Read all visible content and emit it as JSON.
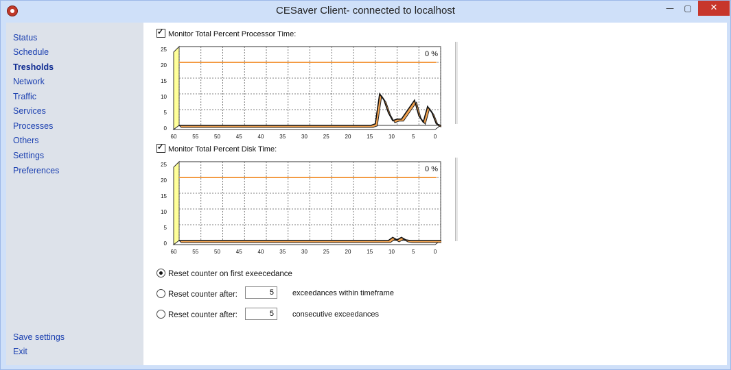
{
  "window": {
    "title": "CESaver Client- connected to localhost",
    "min_icon": "—",
    "max_icon": "▢",
    "close_icon": "✕"
  },
  "sidebar": {
    "items": [
      {
        "label": "Status"
      },
      {
        "label": "Schedule"
      },
      {
        "label": "Tresholds",
        "active": true
      },
      {
        "label": "Network"
      },
      {
        "label": "Traffic"
      },
      {
        "label": "Services"
      },
      {
        "label": "Processes"
      },
      {
        "label": "Others"
      },
      {
        "label": "Settings"
      },
      {
        "label": "Preferences"
      }
    ],
    "bottom": [
      {
        "label": "Save settings"
      },
      {
        "label": "Exit"
      }
    ]
  },
  "monitors": [
    {
      "label": "Monitor Total Percent Processor Time:",
      "checked": true
    },
    {
      "label": "Monitor Total Percent Disk Time:",
      "checked": true
    }
  ],
  "options": {
    "radio1": "Reset counter on first exeecedance",
    "radio2": "Reset counter after:",
    "radio2_value": "5",
    "radio2_suffix": "exceedances within timeframe",
    "radio3": "Reset counter after:",
    "radio3_value": "5",
    "radio3_suffix": "consecutive exceedances",
    "selected": 1
  },
  "colors": {
    "threshold": "#f39b44",
    "series_fill": "#f3a350",
    "axis_fill": "#ffff99",
    "grid": "#555555"
  },
  "chart_data": [
    {
      "type": "line",
      "readout": "0 %",
      "ylim": [
        0,
        25
      ],
      "yticks": [
        0,
        5,
        10,
        15,
        20,
        25
      ],
      "xlim": [
        60,
        0
      ],
      "xticks": [
        60,
        55,
        50,
        45,
        40,
        35,
        30,
        25,
        20,
        15,
        10,
        5,
        0
      ],
      "threshold": 20,
      "x": [
        60,
        50,
        40,
        30,
        20,
        16,
        15,
        14,
        13,
        12,
        11,
        10,
        9,
        8,
        7,
        6,
        5,
        4,
        3,
        2,
        1,
        0
      ],
      "values": [
        0,
        0,
        0,
        0,
        0,
        0,
        0.5,
        10,
        8,
        4,
        1.5,
        2,
        2,
        4,
        6,
        8,
        3,
        1,
        6,
        4,
        0.5,
        0
      ]
    },
    {
      "type": "line",
      "readout": "0 %",
      "ylim": [
        0,
        25
      ],
      "yticks": [
        0,
        5,
        10,
        15,
        20,
        25
      ],
      "xlim": [
        60,
        0
      ],
      "xticks": [
        60,
        55,
        50,
        45,
        40,
        35,
        30,
        25,
        20,
        15,
        10,
        5,
        0
      ],
      "threshold": 20,
      "x": [
        60,
        30,
        15,
        13,
        12,
        11,
        10,
        9,
        8,
        7,
        5,
        0
      ],
      "values": [
        0,
        0,
        0,
        0,
        0,
        1,
        0.2,
        1,
        0.2,
        0,
        0,
        0
      ]
    }
  ]
}
